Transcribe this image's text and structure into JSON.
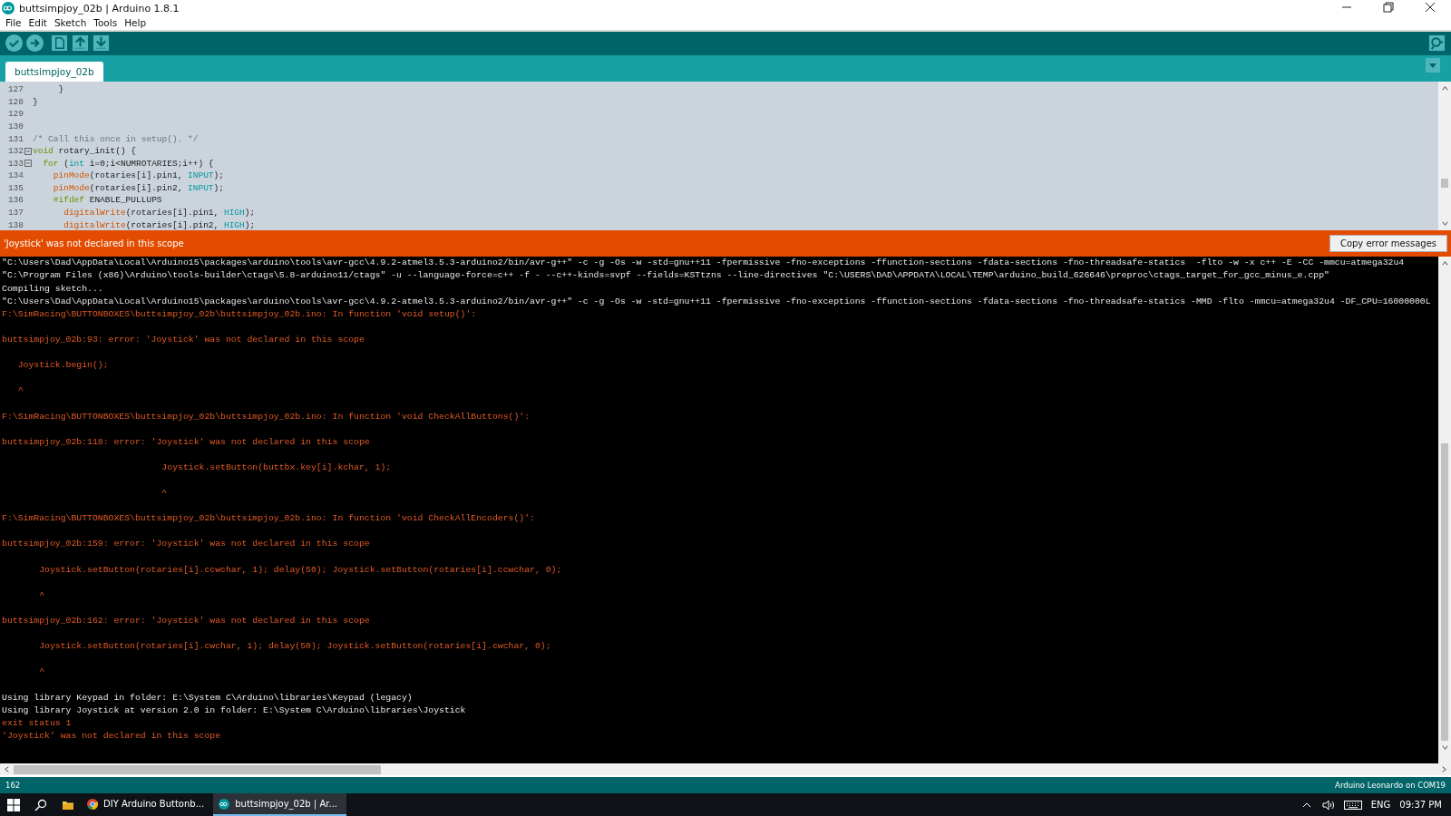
{
  "window": {
    "title": "buttsimpjoy_02b | Arduino 1.8.1"
  },
  "menu": [
    "File",
    "Edit",
    "Sketch",
    "Tools",
    "Help"
  ],
  "tabs": [
    {
      "label": "buttsimpjoy_02b",
      "selected": true
    }
  ],
  "code_lines": [
    {
      "number": "127",
      "fold": false,
      "tokens": [
        {
          "text": "     }",
          "kind": "plain"
        }
      ]
    },
    {
      "number": "128",
      "fold": false,
      "tokens": [
        {
          "text": "}",
          "kind": "plain"
        }
      ]
    },
    {
      "number": "129",
      "fold": false
    },
    {
      "number": "130",
      "fold": false
    },
    {
      "number": "131",
      "fold": false,
      "tokens": [
        {
          "text": "/* Call this once in setup(). */",
          "kind": "comment"
        }
      ]
    },
    {
      "number": "132",
      "fold": true,
      "tokens": [
        {
          "text": "void",
          "kind": "keyword"
        },
        {
          "text": " rotary_init() {",
          "kind": "plain"
        }
      ]
    },
    {
      "number": "133",
      "fold": true,
      "tokens": [
        {
          "text": "  for",
          "kind": "keyword"
        },
        {
          "text": " (",
          "kind": "plain"
        },
        {
          "text": "int",
          "kind": "type"
        },
        {
          "text": " i=0;i<NUMROTARIES;i++) {",
          "kind": "plain"
        }
      ]
    },
    {
      "number": "134",
      "fold": false,
      "tokens": [
        {
          "text": "    pinMode",
          "kind": "function"
        },
        {
          "text": "(rotaries[i].pin1, ",
          "kind": "plain"
        },
        {
          "text": "INPUT",
          "kind": "constant"
        },
        {
          "text": ");",
          "kind": "plain"
        }
      ]
    },
    {
      "number": "135",
      "fold": false,
      "tokens": [
        {
          "text": "    pinMode",
          "kind": "function"
        },
        {
          "text": "(rotaries[i].pin2, ",
          "kind": "plain"
        },
        {
          "text": "INPUT",
          "kind": "constant"
        },
        {
          "text": ");",
          "kind": "plain"
        }
      ]
    },
    {
      "number": "136",
      "fold": false,
      "tokens": [
        {
          "text": "    #ifdef",
          "kind": "keyword"
        },
        {
          "text": " ENABLE_PULLUPS",
          "kind": "plain"
        }
      ]
    },
    {
      "number": "137",
      "fold": false,
      "tokens": [
        {
          "text": "      digitalWrite",
          "kind": "function"
        },
        {
          "text": "(rotaries[i].pin1, ",
          "kind": "plain"
        },
        {
          "text": "HIGH",
          "kind": "constant"
        },
        {
          "text": ");",
          "kind": "plain"
        }
      ]
    },
    {
      "number": "138",
      "fold": false,
      "tokens": [
        {
          "text": "      digitalWrite",
          "kind": "function"
        },
        {
          "text": "(rotaries[i].pin2, ",
          "kind": "plain"
        },
        {
          "text": "HIGH",
          "kind": "constant"
        },
        {
          "text": ");",
          "kind": "plain"
        }
      ]
    }
  ],
  "error_bar": {
    "message": "'Joystick' was not declared in this scope",
    "button": "Copy error messages"
  },
  "console_lines": [
    {
      "kind": "normal",
      "text": "\"C:\\Users\\Dad\\AppData\\Local\\Arduino15\\packages\\arduino\\tools\\avr-gcc\\4.9.2-atmel3.5.3-arduino2/bin/avr-g++\" -c -g -Os -w -std=gnu++11 -fpermissive -fno-exceptions -ffunction-sections -fdata-sections -fno-threadsafe-statics  -flto -w -x c++ -E -CC -mmcu=atmega32u4"
    },
    {
      "kind": "normal",
      "text": "\"C:\\Program Files (x86)\\Arduino\\tools-builder\\ctags\\5.8-arduino11/ctags\" -u --language-force=c++ -f - --c++-kinds=svpf --fields=KSTtzns --line-directives \"C:\\USERS\\DAD\\APPDATA\\LOCAL\\TEMP\\arduino_build_626646\\preproc\\ctags_target_for_gcc_minus_e.cpp\""
    },
    {
      "kind": "normal",
      "text": "Compiling sketch..."
    },
    {
      "kind": "normal",
      "text": "\"C:\\Users\\Dad\\AppData\\Local\\Arduino15\\packages\\arduino\\tools\\avr-gcc\\4.9.2-atmel3.5.3-arduino2/bin/avr-g++\" -c -g -Os -w -std=gnu++11 -fpermissive -fno-exceptions -ffunction-sections -fdata-sections -fno-threadsafe-statics -MMD -flto -mmcu=atmega32u4 -DF_CPU=16000000L"
    },
    {
      "kind": "error",
      "text": "F:\\SimRacing\\BUTTONBOXES\\buttsimpjoy_02b\\buttsimpjoy_02b.ino: In function 'void setup()':"
    },
    {
      "kind": "blank"
    },
    {
      "kind": "error",
      "text": "buttsimpjoy_02b:93: error: 'Joystick' was not declared in this scope"
    },
    {
      "kind": "blank"
    },
    {
      "kind": "error",
      "text": "   Joystick.begin();"
    },
    {
      "kind": "blank"
    },
    {
      "kind": "error",
      "text": "   ^"
    },
    {
      "kind": "blank"
    },
    {
      "kind": "error",
      "text": "F:\\SimRacing\\BUTTONBOXES\\buttsimpjoy_02b\\buttsimpjoy_02b.ino: In function 'void CheckAllButtons()':"
    },
    {
      "kind": "blank"
    },
    {
      "kind": "error",
      "text": "buttsimpjoy_02b:118: error: 'Joystick' was not declared in this scope"
    },
    {
      "kind": "blank"
    },
    {
      "kind": "error",
      "text": "                              Joystick.setButton(buttbx.key[i].kchar, 1);"
    },
    {
      "kind": "blank"
    },
    {
      "kind": "error",
      "text": "                              ^"
    },
    {
      "kind": "blank"
    },
    {
      "kind": "error",
      "text": "F:\\SimRacing\\BUTTONBOXES\\buttsimpjoy_02b\\buttsimpjoy_02b.ino: In function 'void CheckAllEncoders()':"
    },
    {
      "kind": "blank"
    },
    {
      "kind": "error",
      "text": "buttsimpjoy_02b:159: error: 'Joystick' was not declared in this scope"
    },
    {
      "kind": "blank"
    },
    {
      "kind": "error",
      "text": "       Joystick.setButton(rotaries[i].ccwchar, 1); delay(50); Joystick.setButton(rotaries[i].ccwchar, 0);"
    },
    {
      "kind": "blank"
    },
    {
      "kind": "error",
      "text": "       ^"
    },
    {
      "kind": "blank"
    },
    {
      "kind": "error",
      "text": "buttsimpjoy_02b:162: error: 'Joystick' was not declared in this scope"
    },
    {
      "kind": "blank"
    },
    {
      "kind": "error",
      "text": "       Joystick.setButton(rotaries[i].cwchar, 1); delay(50); Joystick.setButton(rotaries[i].cwchar, 0);"
    },
    {
      "kind": "blank"
    },
    {
      "kind": "error",
      "text": "       ^"
    },
    {
      "kind": "blank"
    },
    {
      "kind": "normal",
      "text": "Using library Keypad in folder: E:\\System C\\Arduino\\libraries\\Keypad (legacy)"
    },
    {
      "kind": "normal",
      "text": "Using library Joystick at version 2.0 in folder: E:\\System C\\Arduino\\libraries\\Joystick"
    },
    {
      "kind": "error",
      "text": "exit status 1"
    },
    {
      "kind": "error",
      "text": "'Joystick' was not declared in this scope"
    }
  ],
  "status_bar": {
    "line": "162",
    "board": "Arduino Leonardo on COM19"
  },
  "taskbar": {
    "apps": [
      {
        "label": "DIY Arduino Buttonb...",
        "kind": "browser",
        "selected": false
      },
      {
        "label": "buttsimpjoy_02b | Ar...",
        "kind": "arduino",
        "selected": true
      }
    ],
    "language": "ENG",
    "time": "09:37 PM"
  }
}
